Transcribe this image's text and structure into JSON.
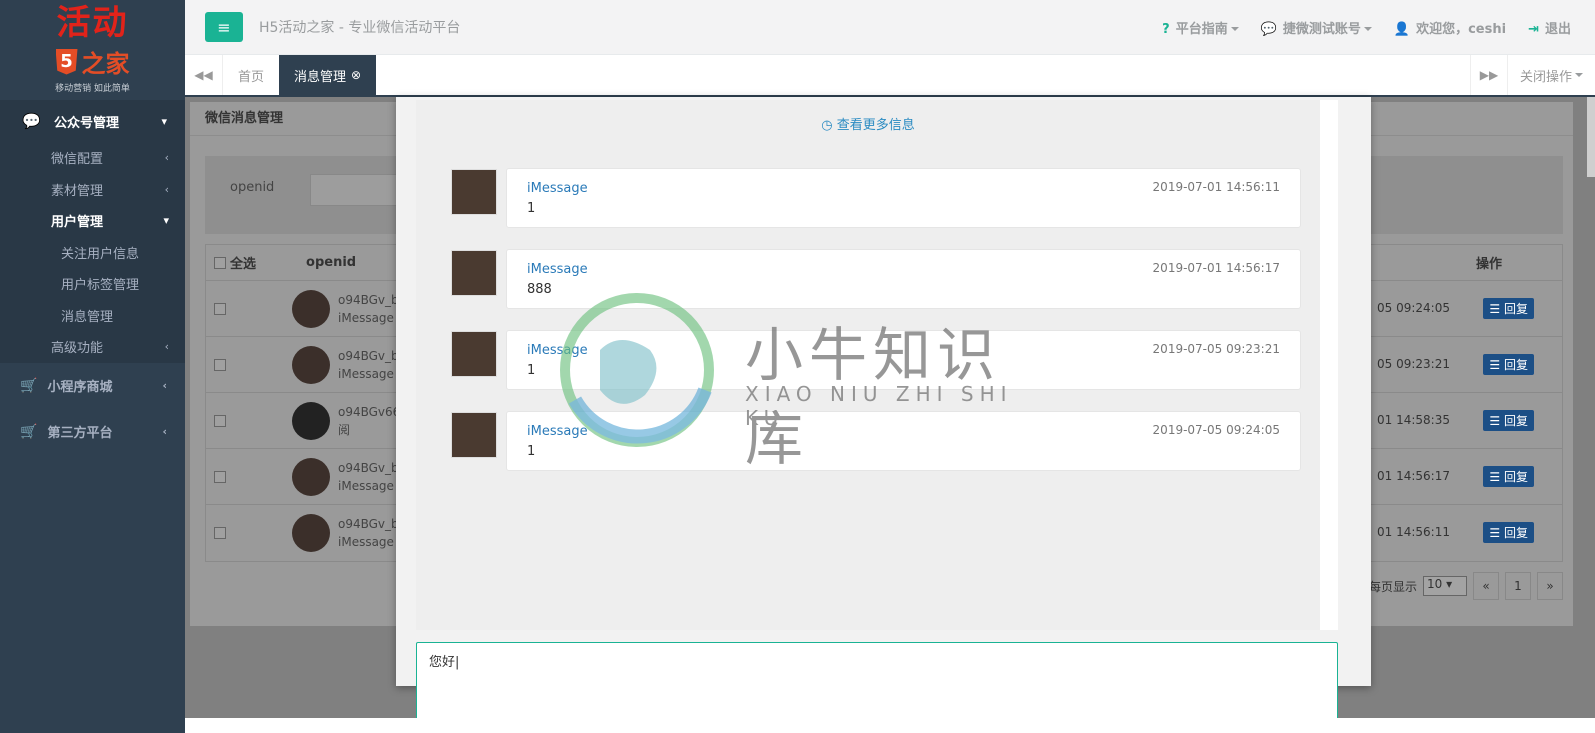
{
  "logo": {
    "main": "活动",
    "five": "5",
    "home": "之家",
    "slogan": "移动营销 如此简单"
  },
  "sidebar": {
    "top": {
      "label": "公众号管理"
    },
    "second": [
      {
        "label": "微信配置"
      },
      {
        "label": "素材管理"
      },
      {
        "label": "用户管理"
      }
    ],
    "third": [
      {
        "label": "关注用户信息"
      },
      {
        "label": "用户标签管理"
      },
      {
        "label": "消息管理"
      }
    ],
    "advanced": {
      "label": "高级功能"
    },
    "mall": {
      "label": "小程序商城"
    },
    "third_party": {
      "label": "第三方平台"
    }
  },
  "topbar": {
    "site_title": "H5活动之家 - 专业微信活动平台",
    "guide": "平台指南",
    "account": "捷微测试账号",
    "welcome": "欢迎您，ceshi",
    "logout": "退出"
  },
  "tabs": {
    "home": "首页",
    "active": "消息管理",
    "close_ops": "关闭操作"
  },
  "underlay": {
    "panel_title": "微信消息管理",
    "search_label": "openid",
    "col_select_all": "全选",
    "col_openid": "openid",
    "col_ops": "操作",
    "rows": [
      {
        "openid": "o94BGv_b",
        "sub": "iMessage",
        "time": "05 09:24:05",
        "reply": "回复"
      },
      {
        "openid": "o94BGv_b",
        "sub": "iMessage",
        "time": "05 09:23:21",
        "reply": "回复"
      },
      {
        "openid": "o94BGv66",
        "sub": "阅",
        "time": "01 14:58:35",
        "reply": "回复"
      },
      {
        "openid": "o94BGv_b",
        "sub": "iMessage",
        "time": "01 14:56:17",
        "reply": "回复"
      },
      {
        "openid": "o94BGv_b",
        "sub": "iMessage",
        "time": "01 14:56:11",
        "reply": "回复"
      }
    ],
    "pager": {
      "per_page_label": "每页显示",
      "per_page": "10",
      "prev": "«",
      "page": "1",
      "next": "»"
    }
  },
  "chat": {
    "more_link": "查看更多信息",
    "messages": [
      {
        "name": "iMessage",
        "text": "1",
        "time": "2019-07-01 14:56:11"
      },
      {
        "name": "iMessage",
        "text": "888",
        "time": "2019-07-01 14:56:17"
      },
      {
        "name": "iMessage",
        "text": "1",
        "time": "2019-07-05 09:23:21"
      },
      {
        "name": "iMessage",
        "text": "1",
        "time": "2019-07-05 09:24:05"
      }
    ],
    "reply_value": "您好"
  },
  "watermark": {
    "title": "小牛知识库",
    "sub": "XIAO NIU ZHI SHI KU"
  },
  "colors": {
    "sidebar": "#2f4050",
    "accent": "#1ab394",
    "link": "#2a7ab8",
    "logo_red": "#e2231a"
  }
}
